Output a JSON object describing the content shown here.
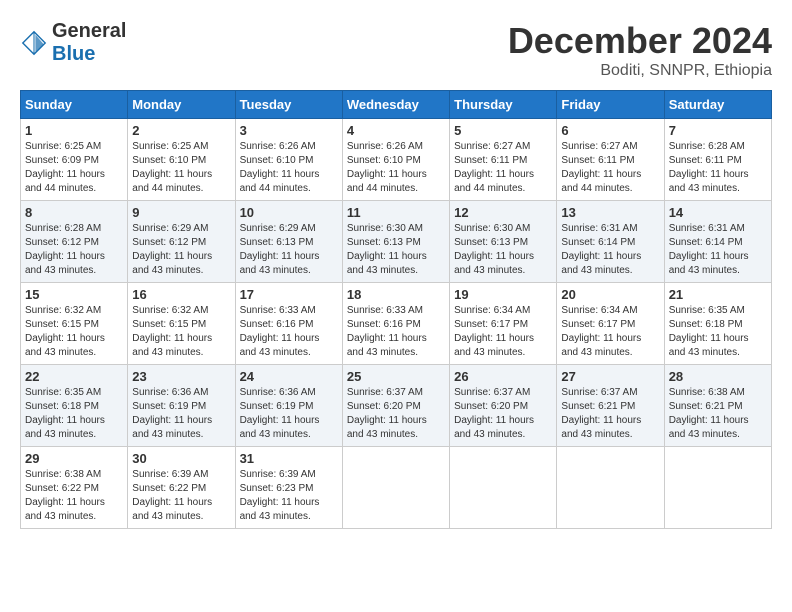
{
  "header": {
    "logo_general": "General",
    "logo_blue": "Blue",
    "month": "December 2024",
    "location": "Boditi, SNNPR, Ethiopia"
  },
  "days_of_week": [
    "Sunday",
    "Monday",
    "Tuesday",
    "Wednesday",
    "Thursday",
    "Friday",
    "Saturday"
  ],
  "weeks": [
    [
      {
        "day": "1",
        "sunrise": "6:25 AM",
        "sunset": "6:09 PM",
        "daylight": "11 hours and 44 minutes."
      },
      {
        "day": "2",
        "sunrise": "6:25 AM",
        "sunset": "6:10 PM",
        "daylight": "11 hours and 44 minutes."
      },
      {
        "day": "3",
        "sunrise": "6:26 AM",
        "sunset": "6:10 PM",
        "daylight": "11 hours and 44 minutes."
      },
      {
        "day": "4",
        "sunrise": "6:26 AM",
        "sunset": "6:10 PM",
        "daylight": "11 hours and 44 minutes."
      },
      {
        "day": "5",
        "sunrise": "6:27 AM",
        "sunset": "6:11 PM",
        "daylight": "11 hours and 44 minutes."
      },
      {
        "day": "6",
        "sunrise": "6:27 AM",
        "sunset": "6:11 PM",
        "daylight": "11 hours and 44 minutes."
      },
      {
        "day": "7",
        "sunrise": "6:28 AM",
        "sunset": "6:11 PM",
        "daylight": "11 hours and 43 minutes."
      }
    ],
    [
      {
        "day": "8",
        "sunrise": "6:28 AM",
        "sunset": "6:12 PM",
        "daylight": "11 hours and 43 minutes."
      },
      {
        "day": "9",
        "sunrise": "6:29 AM",
        "sunset": "6:12 PM",
        "daylight": "11 hours and 43 minutes."
      },
      {
        "day": "10",
        "sunrise": "6:29 AM",
        "sunset": "6:13 PM",
        "daylight": "11 hours and 43 minutes."
      },
      {
        "day": "11",
        "sunrise": "6:30 AM",
        "sunset": "6:13 PM",
        "daylight": "11 hours and 43 minutes."
      },
      {
        "day": "12",
        "sunrise": "6:30 AM",
        "sunset": "6:13 PM",
        "daylight": "11 hours and 43 minutes."
      },
      {
        "day": "13",
        "sunrise": "6:31 AM",
        "sunset": "6:14 PM",
        "daylight": "11 hours and 43 minutes."
      },
      {
        "day": "14",
        "sunrise": "6:31 AM",
        "sunset": "6:14 PM",
        "daylight": "11 hours and 43 minutes."
      }
    ],
    [
      {
        "day": "15",
        "sunrise": "6:32 AM",
        "sunset": "6:15 PM",
        "daylight": "11 hours and 43 minutes."
      },
      {
        "day": "16",
        "sunrise": "6:32 AM",
        "sunset": "6:15 PM",
        "daylight": "11 hours and 43 minutes."
      },
      {
        "day": "17",
        "sunrise": "6:33 AM",
        "sunset": "6:16 PM",
        "daylight": "11 hours and 43 minutes."
      },
      {
        "day": "18",
        "sunrise": "6:33 AM",
        "sunset": "6:16 PM",
        "daylight": "11 hours and 43 minutes."
      },
      {
        "day": "19",
        "sunrise": "6:34 AM",
        "sunset": "6:17 PM",
        "daylight": "11 hours and 43 minutes."
      },
      {
        "day": "20",
        "sunrise": "6:34 AM",
        "sunset": "6:17 PM",
        "daylight": "11 hours and 43 minutes."
      },
      {
        "day": "21",
        "sunrise": "6:35 AM",
        "sunset": "6:18 PM",
        "daylight": "11 hours and 43 minutes."
      }
    ],
    [
      {
        "day": "22",
        "sunrise": "6:35 AM",
        "sunset": "6:18 PM",
        "daylight": "11 hours and 43 minutes."
      },
      {
        "day": "23",
        "sunrise": "6:36 AM",
        "sunset": "6:19 PM",
        "daylight": "11 hours and 43 minutes."
      },
      {
        "day": "24",
        "sunrise": "6:36 AM",
        "sunset": "6:19 PM",
        "daylight": "11 hours and 43 minutes."
      },
      {
        "day": "25",
        "sunrise": "6:37 AM",
        "sunset": "6:20 PM",
        "daylight": "11 hours and 43 minutes."
      },
      {
        "day": "26",
        "sunrise": "6:37 AM",
        "sunset": "6:20 PM",
        "daylight": "11 hours and 43 minutes."
      },
      {
        "day": "27",
        "sunrise": "6:37 AM",
        "sunset": "6:21 PM",
        "daylight": "11 hours and 43 minutes."
      },
      {
        "day": "28",
        "sunrise": "6:38 AM",
        "sunset": "6:21 PM",
        "daylight": "11 hours and 43 minutes."
      }
    ],
    [
      {
        "day": "29",
        "sunrise": "6:38 AM",
        "sunset": "6:22 PM",
        "daylight": "11 hours and 43 minutes."
      },
      {
        "day": "30",
        "sunrise": "6:39 AM",
        "sunset": "6:22 PM",
        "daylight": "11 hours and 43 minutes."
      },
      {
        "day": "31",
        "sunrise": "6:39 AM",
        "sunset": "6:23 PM",
        "daylight": "11 hours and 43 minutes."
      },
      null,
      null,
      null,
      null
    ]
  ],
  "labels": {
    "sunrise": "Sunrise:",
    "sunset": "Sunset:",
    "daylight": "Daylight:"
  }
}
